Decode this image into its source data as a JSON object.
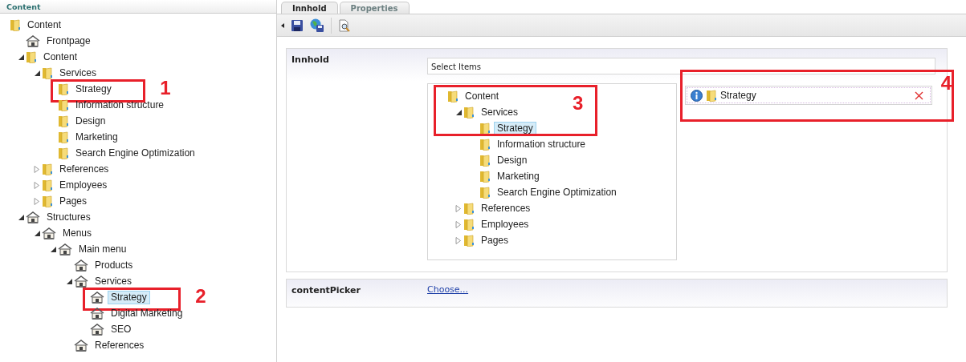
{
  "sidebar": {
    "title": "Content",
    "tree": [
      {
        "label": "Content",
        "kind": "folder",
        "selected": false,
        "children": [
          {
            "label": "Frontpage",
            "kind": "house",
            "selected": false
          },
          {
            "label": "Content",
            "kind": "folder",
            "expanded": true,
            "selected": false,
            "children": [
              {
                "label": "Services",
                "kind": "folder",
                "expanded": true,
                "selected": false,
                "children": [
                  {
                    "label": "Strategy",
                    "kind": "folder",
                    "selected": false,
                    "annotation": "1"
                  },
                  {
                    "label": "Information structure",
                    "kind": "folder",
                    "selected": false
                  },
                  {
                    "label": "Design",
                    "kind": "folder",
                    "selected": false
                  },
                  {
                    "label": "Marketing",
                    "kind": "folder",
                    "selected": false
                  },
                  {
                    "label": "Search Engine Optimization",
                    "kind": "folder",
                    "selected": false
                  }
                ]
              },
              {
                "label": "References",
                "kind": "folder",
                "expanded": false,
                "selected": false
              },
              {
                "label": "Employees",
                "kind": "folder",
                "expanded": false,
                "selected": false
              },
              {
                "label": "Pages",
                "kind": "folder",
                "expanded": false,
                "selected": false
              }
            ]
          },
          {
            "label": "Structures",
            "kind": "house",
            "expanded": true,
            "selected": false,
            "children": [
              {
                "label": "Menus",
                "kind": "house",
                "expanded": true,
                "selected": false,
                "children": [
                  {
                    "label": "Main menu",
                    "kind": "house",
                    "expanded": true,
                    "selected": false,
                    "children": [
                      {
                        "label": "Products",
                        "kind": "house",
                        "selected": false
                      },
                      {
                        "label": "Services",
                        "kind": "house",
                        "expanded": true,
                        "selected": false,
                        "children": [
                          {
                            "label": "Strategy",
                            "kind": "house",
                            "selected": true,
                            "annotation": "2"
                          },
                          {
                            "label": "Digital Marketing",
                            "kind": "house",
                            "selected": false
                          },
                          {
                            "label": "SEO",
                            "kind": "house",
                            "selected": false
                          }
                        ]
                      },
                      {
                        "label": "References",
                        "kind": "house",
                        "selected": false
                      }
                    ]
                  }
                ]
              }
            ]
          }
        ]
      }
    ]
  },
  "tabs": [
    {
      "label": "Innhold",
      "selected": true
    },
    {
      "label": "Properties",
      "selected": false
    }
  ],
  "properties": [
    {
      "kind": "picker",
      "label": "Innhold",
      "picker_title": "Select Items",
      "tree_annotation": "3",
      "tree": [
        {
          "label": "Content",
          "kind": "folder",
          "selected": false,
          "children": [
            {
              "label": "Services",
              "kind": "folder",
              "expanded": true,
              "selected": false,
              "children": [
                {
                  "label": "Strategy",
                  "kind": "folder",
                  "selected": true
                },
                {
                  "label": "Information structure",
                  "kind": "folder",
                  "selected": false
                },
                {
                  "label": "Design",
                  "kind": "folder",
                  "selected": false
                },
                {
                  "label": "Marketing",
                  "kind": "folder",
                  "selected": false
                },
                {
                  "label": "Search Engine Optimization",
                  "kind": "folder",
                  "selected": false
                }
              ]
            },
            {
              "label": "References",
              "kind": "folder",
              "expanded": false,
              "selected": false
            },
            {
              "label": "Employees",
              "kind": "folder",
              "expanded": false,
              "selected": false
            },
            {
              "label": "Pages",
              "kind": "folder",
              "expanded": false,
              "selected": false
            }
          ]
        }
      ],
      "selected_items": [
        {
          "label": "Strategy",
          "annotation": "4"
        }
      ]
    },
    {
      "kind": "link",
      "label": "contentPicker",
      "link": "Choose..."
    }
  ]
}
